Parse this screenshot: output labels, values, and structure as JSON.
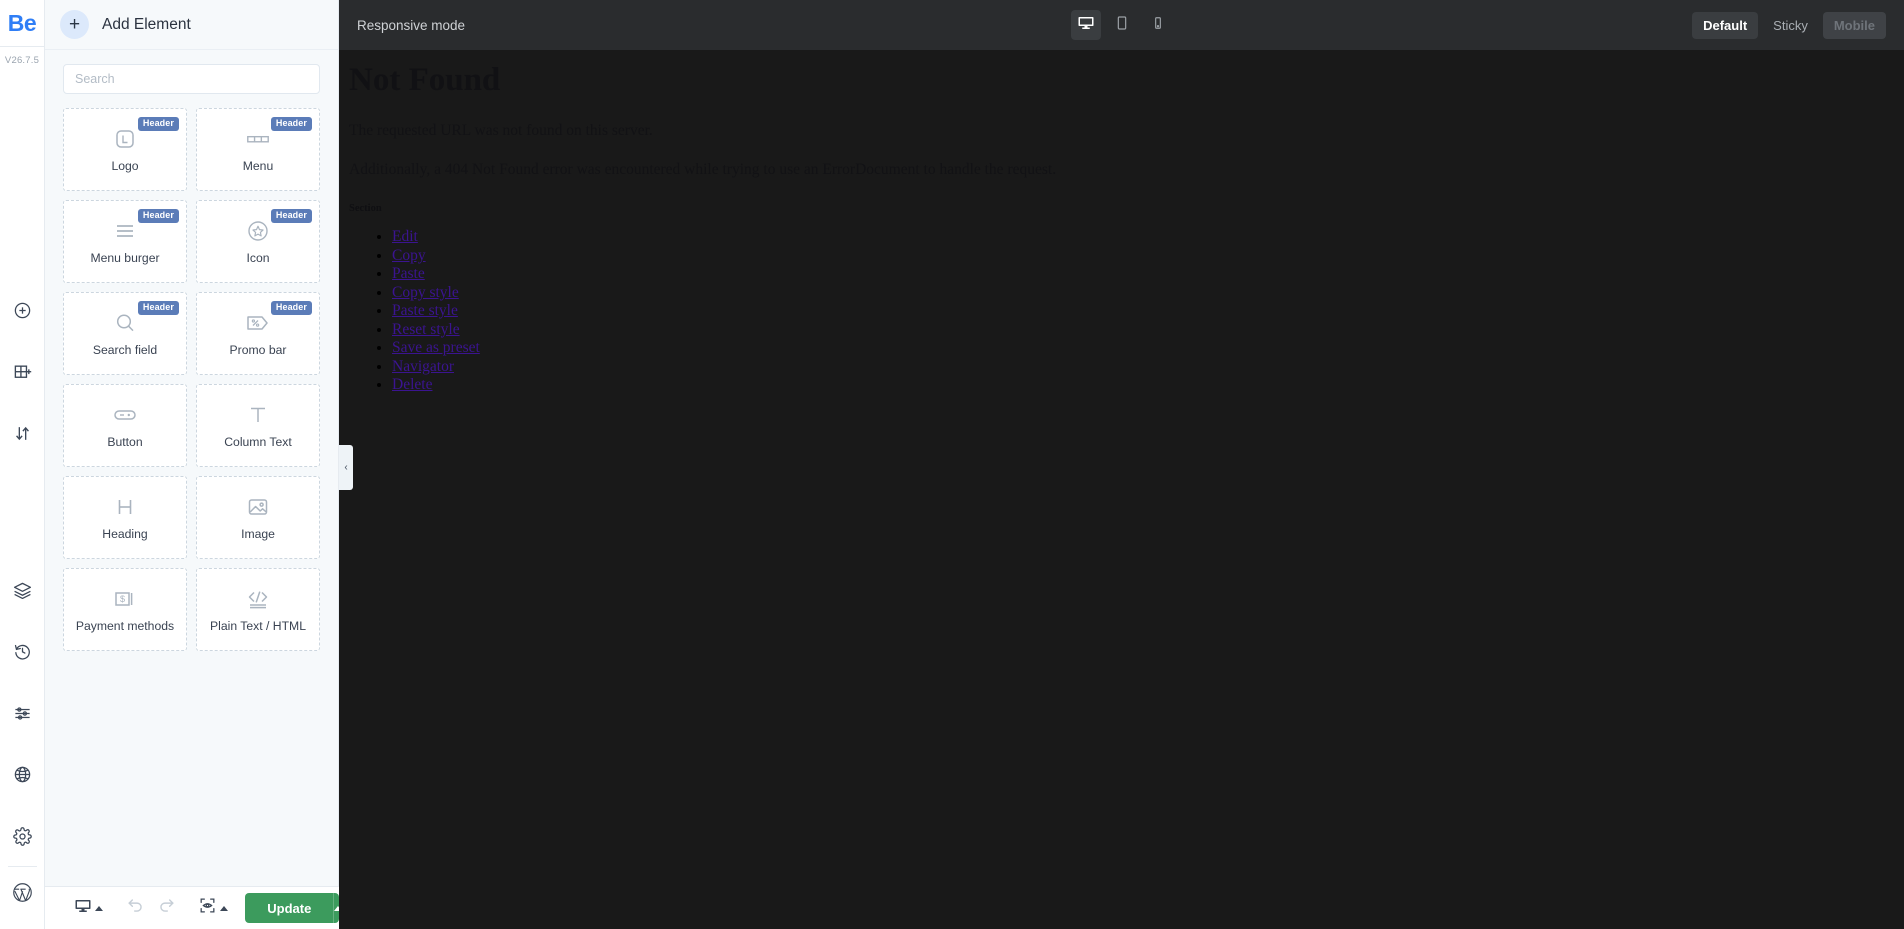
{
  "rail": {
    "logo_text": "Be",
    "version": "V26.7.5",
    "icons": [
      {
        "name": "add-circle-icon",
        "label": "Add"
      },
      {
        "name": "add-block-icon",
        "label": "Add block"
      },
      {
        "name": "sort-arrows-icon",
        "label": "Reorder"
      },
      {
        "name": "layers-icon",
        "label": "Layers"
      },
      {
        "name": "history-icon",
        "label": "History"
      },
      {
        "name": "sliders-icon",
        "label": "Settings sliders"
      },
      {
        "name": "globe-icon",
        "label": "Global"
      },
      {
        "name": "gear-icon",
        "label": "Settings"
      },
      {
        "name": "wordpress-icon",
        "label": "WordPress"
      }
    ]
  },
  "panel": {
    "title": "Add Element",
    "add_button_glyph": "+",
    "search": {
      "placeholder": "Search",
      "value": ""
    },
    "badge_label": "Header",
    "badge_color": "#5b7cb8",
    "elements": [
      {
        "label": "Logo",
        "icon": "logo-icon",
        "badge": "Header"
      },
      {
        "label": "Menu",
        "icon": "menu-icon",
        "badge": "Header"
      },
      {
        "label": "Menu burger",
        "icon": "menu-burger-icon",
        "badge": "Header"
      },
      {
        "label": "Icon",
        "icon": "star-circle-icon",
        "badge": "Header"
      },
      {
        "label": "Search field",
        "icon": "search-icon",
        "badge": "Header"
      },
      {
        "label": "Promo bar",
        "icon": "promo-tag-icon",
        "badge": "Header"
      },
      {
        "label": "Button",
        "icon": "button-icon",
        "badge": ""
      },
      {
        "label": "Column Text",
        "icon": "text-t-icon",
        "badge": ""
      },
      {
        "label": "Heading",
        "icon": "heading-h-icon",
        "badge": ""
      },
      {
        "label": "Image",
        "icon": "image-icon",
        "badge": ""
      },
      {
        "label": "Payment methods",
        "icon": "payment-card-icon",
        "badge": ""
      },
      {
        "label": "Plain Text / HTML",
        "icon": "code-icon",
        "badge": ""
      }
    ]
  },
  "panel_footer": {
    "device_name": "desktop-icon",
    "undo_name": "undo-icon",
    "redo_name": "redo-icon",
    "preview_name": "preview-eye-icon",
    "update_label": "Update"
  },
  "collapse_handle": {
    "glyph": "‹"
  },
  "topbar": {
    "title": "Responsive mode",
    "devices": [
      {
        "name": "desktop-icon",
        "active": true
      },
      {
        "name": "tablet-icon",
        "active": false
      },
      {
        "name": "mobile-icon",
        "active": false
      }
    ],
    "modes": [
      {
        "label": "Default",
        "state": "active"
      },
      {
        "label": "Sticky",
        "state": "normal"
      },
      {
        "label": "Mobile",
        "state": "disabled"
      }
    ]
  },
  "canvas": {
    "heading": "Not Found",
    "paragraphs": [
      "The requested URL was not found on this server.",
      "Additionally, a 404 Not Found error was encountered while trying to use an ErrorDocument to handle the request."
    ],
    "section_label": "Section",
    "menu_links": [
      "Edit",
      "Copy",
      "Paste",
      "Copy style",
      "Paste style",
      "Reset style",
      "Save as preset",
      "Navigator",
      "Delete"
    ],
    "background_color": "#191919",
    "link_color": "#3b1490"
  }
}
